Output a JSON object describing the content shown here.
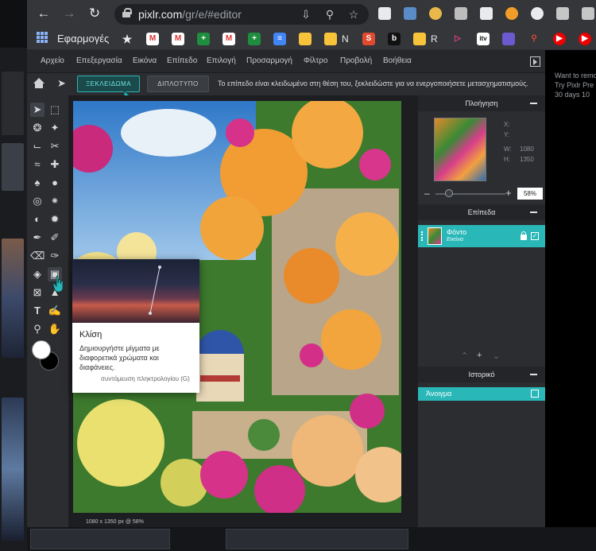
{
  "browser": {
    "url_host": "pixlr.com",
    "url_path": "/gr/e/#editor",
    "bookmarks_label": "Εφαρμογές",
    "bookmark_texts": [
      "N",
      "R"
    ]
  },
  "menu": [
    "Αρχείο",
    "Επεξεργασία",
    "Εικόνα",
    "Επίπεδο",
    "Επιλογή",
    "Προσαρμογή",
    "Φίλτρο",
    "Προβολή",
    "Βοήθεια"
  ],
  "options": {
    "unlock_label": "ΞΕΚΛΕΙΔΩΜΑ",
    "duplicate_label": "ΔΙΠΛΟΤΥΠΟ",
    "message": "Το επίπεδο είναι κλειδωμένο στη θέση του, ξεκλειδώστε για να ενεργοποιήσετε μετασχηματισμούς."
  },
  "tooltip": {
    "title": "Κλίση",
    "body": "Δημιουργήστε μίγματα με διαφορετικά χρώματα και διαφάνειες.",
    "shortcut": "συντόμευση πληκτρολογίου (G)"
  },
  "canvas": {
    "status": "1080 x 1350 px @ 58%"
  },
  "navigation": {
    "title": "Πλοήγηση",
    "x_label": "X:",
    "y_label": "Y:",
    "w_label": "W:",
    "h_label": "H:",
    "w_value": "1080",
    "h_value": "1350",
    "zoom": "58%",
    "zoom_level": 0.58
  },
  "layers": {
    "title": "Επίπεδα",
    "items": [
      {
        "name": "Φόντο",
        "type": "Εικόνα"
      }
    ]
  },
  "history": {
    "title": "Ιστορικό",
    "items": [
      {
        "name": "Άνοιγμα"
      }
    ]
  },
  "background_app": {
    "lines": [
      "Want to remo",
      "Try Pixlr Pre",
      "30 days 10"
    ]
  },
  "colors": {
    "accent": "#2ab7b8",
    "panel_bg": "#2b2d31",
    "header_bg": "#232528",
    "menu_bg": "#26282c"
  }
}
